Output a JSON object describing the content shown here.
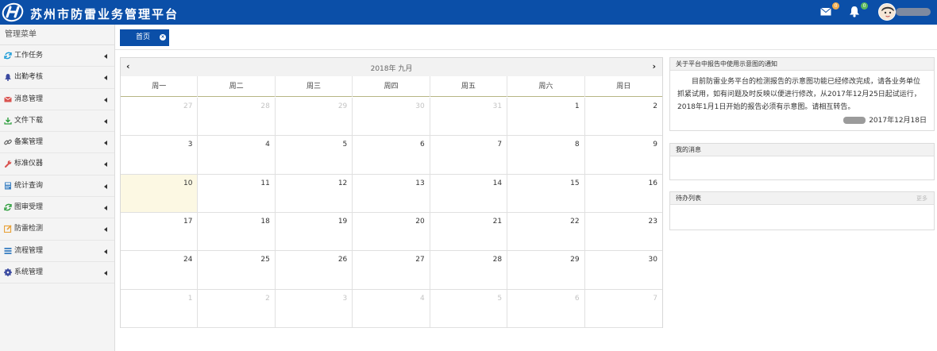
{
  "header": {
    "title": "苏州市防雷业务管理平台",
    "mail_badge": "0",
    "bell_badge": "0",
    "colors": {
      "bar": "#0b4fa8",
      "mail_badge": "#f0ad4e",
      "bell_badge": "#5cb85c"
    }
  },
  "sidebar": {
    "title": "管理菜单",
    "items": [
      {
        "label": "工作任务",
        "icon": "refresh-icon",
        "color": "#1a9bd7"
      },
      {
        "label": "出勤考核",
        "icon": "bell-icon",
        "color": "#3b4aa0"
      },
      {
        "label": "消息管理",
        "icon": "envelope-icon",
        "color": "#d9534f"
      },
      {
        "label": "文件下载",
        "icon": "download-icon",
        "color": "#2e9e3e"
      },
      {
        "label": "备案管理",
        "icon": "link-icon",
        "color": "#555555"
      },
      {
        "label": "标准仪器",
        "icon": "wrench-icon",
        "color": "#d9534f"
      },
      {
        "label": "统计查询",
        "icon": "calculator-icon",
        "color": "#3a7fc1"
      },
      {
        "label": "图审受理",
        "icon": "refresh-icon",
        "color": "#2e9e3e"
      },
      {
        "label": "防雷检测",
        "icon": "edit-icon",
        "color": "#e8a33c"
      },
      {
        "label": "流程管理",
        "icon": "list-icon",
        "color": "#3a7fc1"
      },
      {
        "label": "系统管理",
        "icon": "gear-icon",
        "color": "#3b4aa0"
      }
    ]
  },
  "tabs": {
    "home_label": "首页",
    "close": "×"
  },
  "calendar": {
    "title": "2018年 九月",
    "prev": "‹",
    "next": "›",
    "weekdays": [
      "周一",
      "周二",
      "周三",
      "周四",
      "周五",
      "周六",
      "周日"
    ],
    "days": [
      {
        "n": "27",
        "other": true
      },
      {
        "n": "28",
        "other": true
      },
      {
        "n": "29",
        "other": true
      },
      {
        "n": "30",
        "other": true
      },
      {
        "n": "31",
        "other": true
      },
      {
        "n": "1"
      },
      {
        "n": "2"
      },
      {
        "n": "3"
      },
      {
        "n": "4"
      },
      {
        "n": "5"
      },
      {
        "n": "6"
      },
      {
        "n": "7"
      },
      {
        "n": "8"
      },
      {
        "n": "9"
      },
      {
        "n": "10",
        "today": true
      },
      {
        "n": "11"
      },
      {
        "n": "12"
      },
      {
        "n": "13"
      },
      {
        "n": "14"
      },
      {
        "n": "15"
      },
      {
        "n": "16"
      },
      {
        "n": "17"
      },
      {
        "n": "18"
      },
      {
        "n": "19"
      },
      {
        "n": "20"
      },
      {
        "n": "21"
      },
      {
        "n": "22"
      },
      {
        "n": "23"
      },
      {
        "n": "24"
      },
      {
        "n": "25"
      },
      {
        "n": "26"
      },
      {
        "n": "27"
      },
      {
        "n": "28"
      },
      {
        "n": "29"
      },
      {
        "n": "30"
      },
      {
        "n": "1",
        "other": true
      },
      {
        "n": "2",
        "other": true
      },
      {
        "n": "3",
        "other": true
      },
      {
        "n": "4",
        "other": true
      },
      {
        "n": "5",
        "other": true
      },
      {
        "n": "6",
        "other": true
      },
      {
        "n": "7",
        "other": true
      }
    ]
  },
  "notice": {
    "title": "关于平台中报告中使用示意图的通知",
    "text": "目前防雷业务平台的检测报告的示意图功能已经修改完成，请各业务单位抓紧试用，如有问题及时反映以便进行修改，从2017年12月25日起试运行，2018年1月1日开始的报告必须有示意图。请相互转告。",
    "date": "2017年12月18日"
  },
  "messages": {
    "title": "我的消息"
  },
  "todo": {
    "title": "待办列表",
    "more": "更多"
  }
}
